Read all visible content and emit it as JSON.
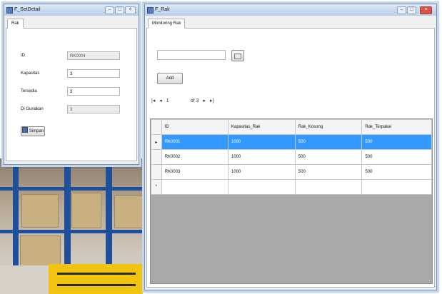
{
  "rak_window": {
    "title": "F_SetDetail",
    "tab": "Rak",
    "fields": [
      {
        "label": "ID",
        "value": "RK0004",
        "readonly": true
      },
      {
        "label": "Kapasitas",
        "value": "3",
        "readonly": false
      },
      {
        "label": "Tersedia",
        "value": "3",
        "readonly": false
      },
      {
        "label": "Di Gunakan",
        "value": "3",
        "readonly": true
      }
    ],
    "save_label": "Simpan"
  },
  "main_window": {
    "title": "F_Rak",
    "tab": "Monitoring Rak",
    "search_value": "",
    "add_label": "Add",
    "navigator": {
      "current": "1",
      "of_label": "of 3"
    },
    "columns": [
      "ID",
      "Kapasitas_Rak",
      "Rak_Kosong",
      "Rak_Terpakai"
    ],
    "rows": [
      [
        "RK0001",
        "1000",
        "500",
        "500"
      ],
      [
        "RK0002",
        "1000",
        "500",
        "500"
      ],
      [
        "RK0003",
        "1000",
        "500",
        "500"
      ]
    ]
  },
  "colors": {
    "selection": "#3399ff",
    "title_gradient": "#c4d8ef",
    "close_button": "#d9554a"
  }
}
